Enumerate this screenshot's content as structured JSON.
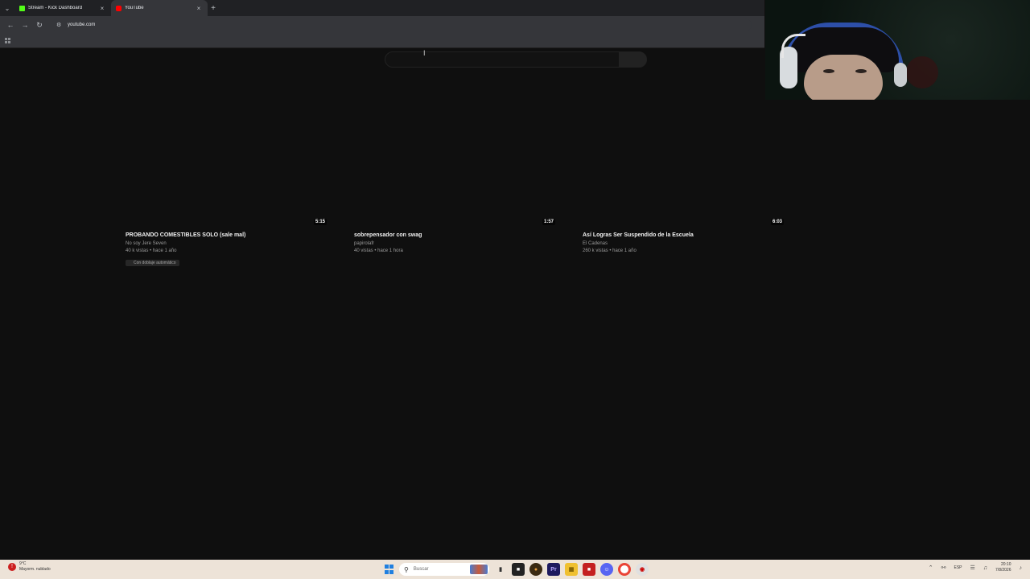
{
  "browser": {
    "tabs": [
      {
        "title": "Stream - Kick Dashboard",
        "active": false,
        "favicon": "kick-logo-icon"
      },
      {
        "title": "YouTube",
        "active": true,
        "favicon": "youtube-logo-icon"
      }
    ],
    "url": "youtube.com"
  },
  "youtube": {
    "search_placeholder": "",
    "videos": [
      {
        "title": "PROBANDO COMESTIBLES SOLO (sale mal)",
        "channel": "No soy Jere Seven",
        "meta": "40 k vistas • hace 1 año",
        "duration": "5:15",
        "badge": "Con doblaje automático"
      },
      {
        "title": "sobrepensador con swag",
        "channel": "papirolafr",
        "meta": "40 vistas • hace 1 hora",
        "duration": "1:57",
        "badge": ""
      },
      {
        "title": "Así Logras Ser Suspendido de la Escuela",
        "channel": "El Cadenas",
        "meta": "260 k vistas • hace 1 año",
        "duration": "6:03",
        "badge": ""
      }
    ]
  },
  "taskbar": {
    "weather_temp": "9°C",
    "weather_desc": "Mayorm. nublado",
    "search_label": "Buscar",
    "language": "ESP",
    "time": "20:10",
    "date": "7/8/2026"
  },
  "colors": {
    "page_bg": "#0f0f0f",
    "chrome_bg": "#35363a",
    "tabstrip_bg": "#202124",
    "taskbar_bg": "#ede3d8",
    "youtube_red": "#ff0000",
    "kick_green": "#53fc18"
  }
}
